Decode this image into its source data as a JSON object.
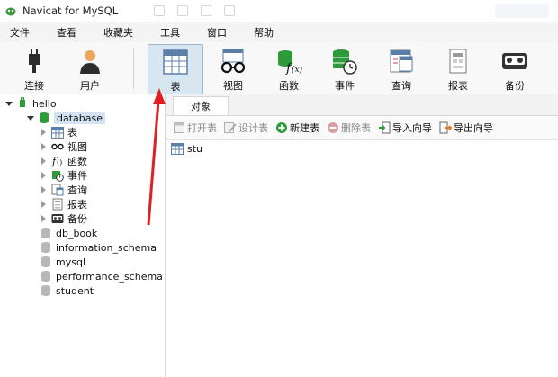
{
  "window": {
    "title": "Navicat for MySQL"
  },
  "menu": [
    "文件",
    "查看",
    "收藏夹",
    "工具",
    "窗口",
    "帮助"
  ],
  "toolbar": {
    "buttons": [
      {
        "label": "连接",
        "icon": "plug-icon"
      },
      {
        "label": "用户",
        "icon": "user-icon"
      },
      {
        "label": "表",
        "icon": "table-icon",
        "active": true
      },
      {
        "label": "视图",
        "icon": "glasses-icon"
      },
      {
        "label": "函数",
        "icon": "function-icon"
      },
      {
        "label": "事件",
        "icon": "event-clock-icon"
      },
      {
        "label": "查询",
        "icon": "query-icon"
      },
      {
        "label": "报表",
        "icon": "report-icon"
      },
      {
        "label": "备份",
        "icon": "backup-icon"
      }
    ]
  },
  "tree": {
    "connection": "hello",
    "database": "database",
    "database_children": [
      "表",
      "视图",
      "函数",
      "事件",
      "查询",
      "报表",
      "备份"
    ],
    "other_databases": [
      "db_book",
      "information_schema",
      "mysql",
      "performance_schema",
      "student"
    ]
  },
  "tabs": [
    "对象"
  ],
  "object_toolbar": [
    {
      "label": "打开表",
      "enabled": false
    },
    {
      "label": "设计表",
      "enabled": false
    },
    {
      "label": "新建表",
      "enabled": true
    },
    {
      "label": "删除表",
      "enabled": false
    },
    {
      "label": "导入向导",
      "enabled": true
    },
    {
      "label": "导出向导",
      "enabled": true
    }
  ],
  "objects": [
    "stu"
  ],
  "colors": {
    "active_button_bg": "#d8e6f2",
    "selection_bg": "#d3e3f3",
    "db_green": "#2e9b3a",
    "annotation_red": "#e02020"
  }
}
